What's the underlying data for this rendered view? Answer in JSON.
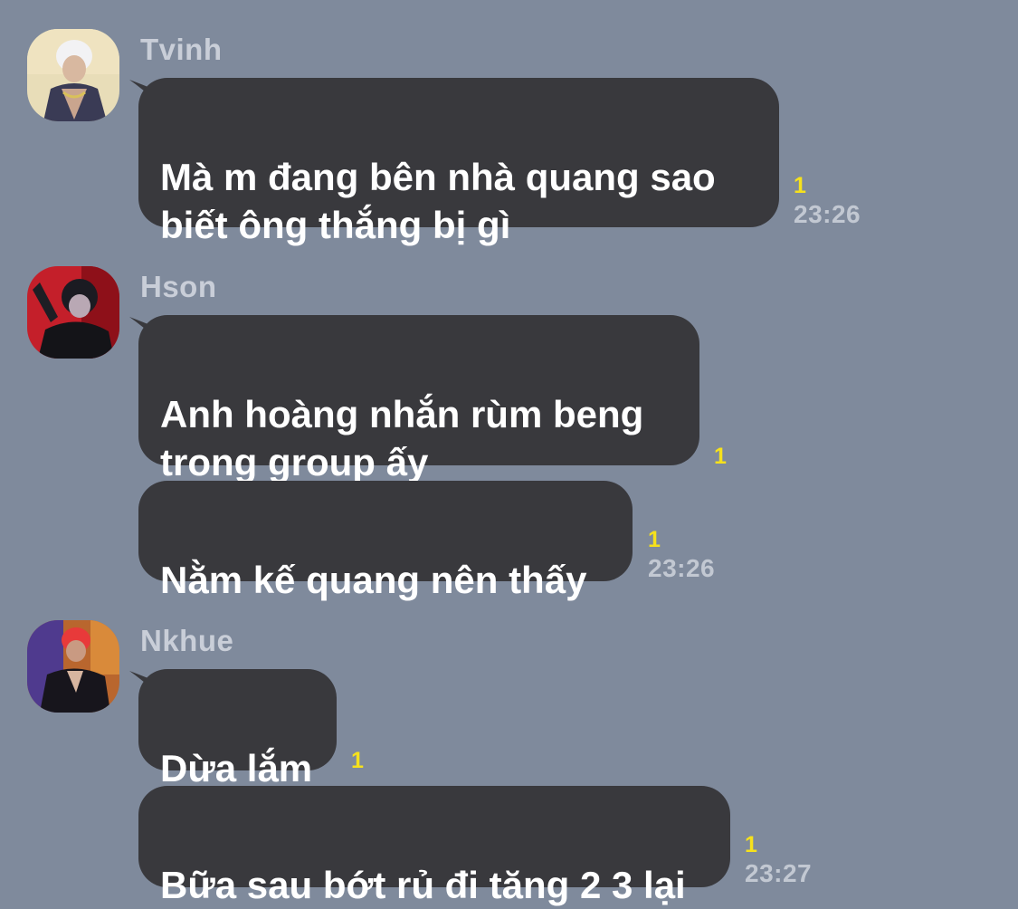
{
  "messages": [
    {
      "sender": "Tvinh",
      "bubbles": [
        {
          "text": "Mà m đang bên nhà quang sao\nbiết ông thắng bị gì",
          "unread": "1",
          "time": "23:26"
        }
      ]
    },
    {
      "sender": "Hson",
      "bubbles": [
        {
          "text": "Anh hoàng nhắn rùm beng\ntrong group ấy",
          "unread": "1"
        },
        {
          "text": "Nằm kế quang nên thấy",
          "unread": "1",
          "time": "23:26"
        }
      ]
    },
    {
      "sender": "Nkhue",
      "bubbles": [
        {
          "text": "Dừa lắm",
          "unread": "1"
        },
        {
          "text": "Bữa sau bớt rủ đi tăng 2 3 lại",
          "unread": "1",
          "time": "23:27"
        }
      ]
    }
  ],
  "colors": {
    "background": "#7f8a9c",
    "bubble": "#39393d",
    "unread": "#f6e11c",
    "time": "#c2c8d2",
    "sender": "#c9ced8"
  },
  "icons": {
    "avatar_0": "profile-photo",
    "avatar_1": "profile-photo",
    "avatar_2": "profile-photo"
  }
}
